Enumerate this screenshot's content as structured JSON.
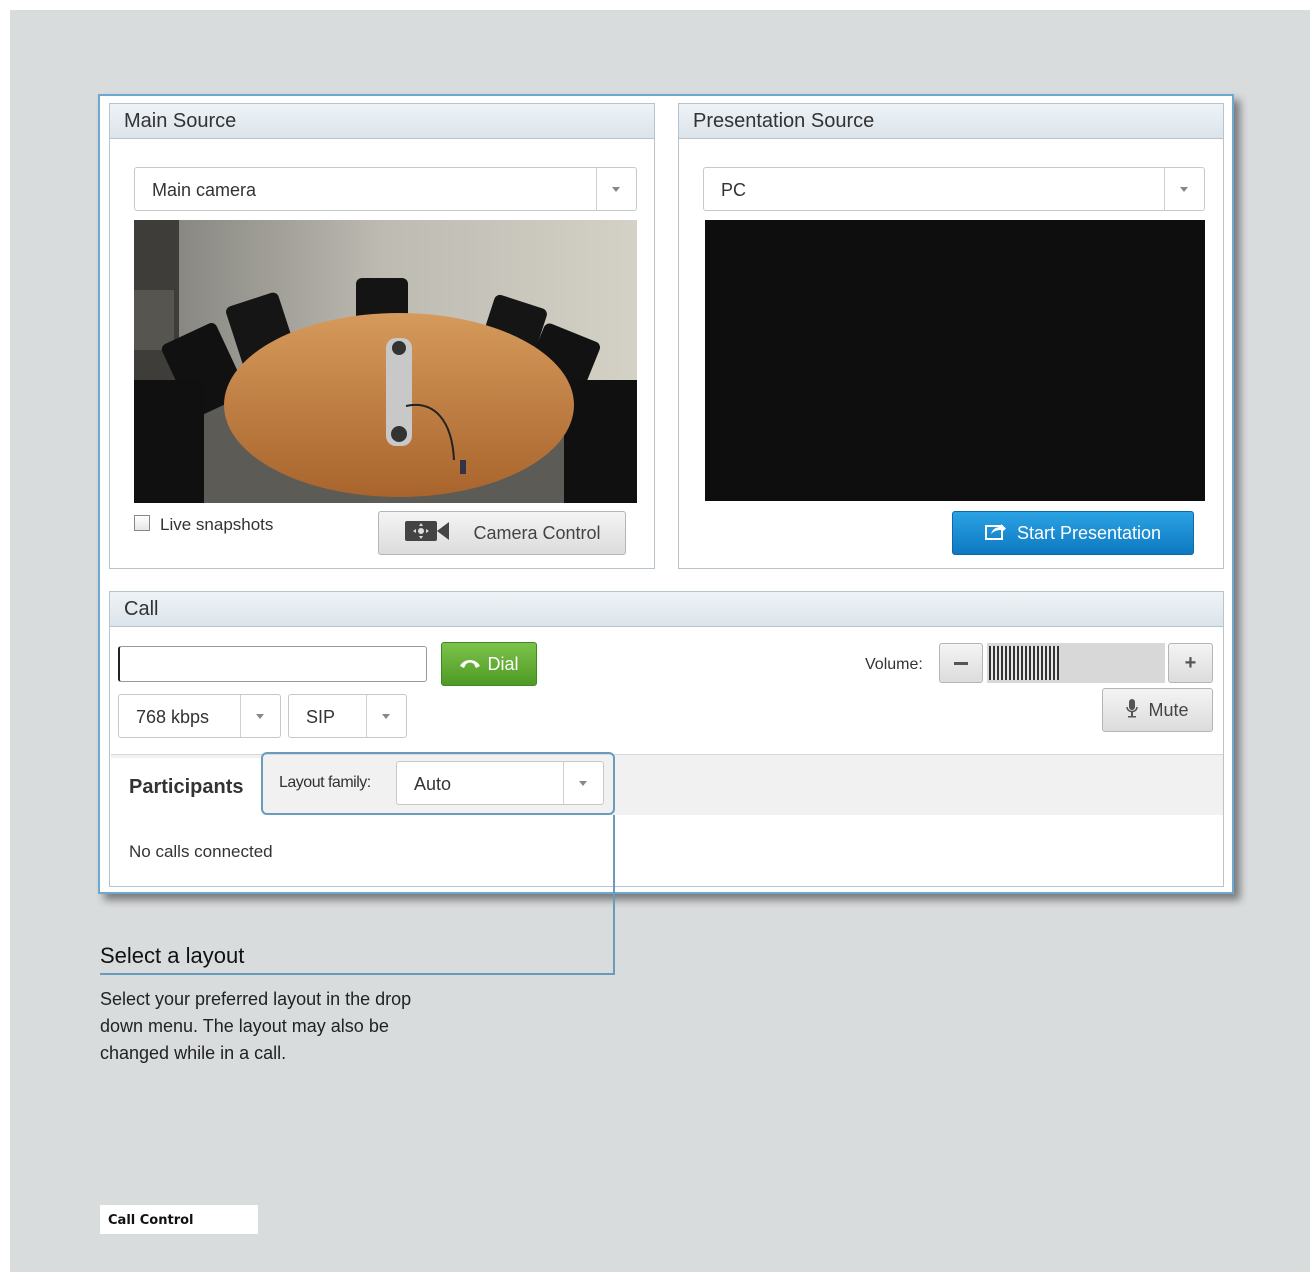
{
  "main_source": {
    "title": "Main Source",
    "source_select": "Main camera",
    "live_snapshots_label": "Live snapshots",
    "camera_control_label": "Camera Control"
  },
  "presentation_source": {
    "title": "Presentation Source",
    "source_select": "PC",
    "start_label": "Start Presentation"
  },
  "call": {
    "title": "Call",
    "dial_input_value": "",
    "dial_label": "Dial",
    "bandwidth": "768 kbps",
    "protocol": "SIP",
    "volume_label": "Volume:",
    "volume_level": 0.4,
    "mute_label": "Mute",
    "participants_tab": "Participants",
    "layout_family_label": "Layout family:",
    "layout_family_value": "Auto",
    "no_calls_text": "No calls connected"
  },
  "annotation": {
    "title": "Select a layout",
    "body": "Select your preferred layout in the drop down menu. The layout may also be changed while in a call."
  },
  "footer": {
    "label": "Call Control"
  },
  "colors": {
    "accent_blue": "#1a8fd6",
    "dial_green": "#5aa832",
    "callout_line": "#6a9bbd",
    "page_bg": "#d9dcdd"
  }
}
